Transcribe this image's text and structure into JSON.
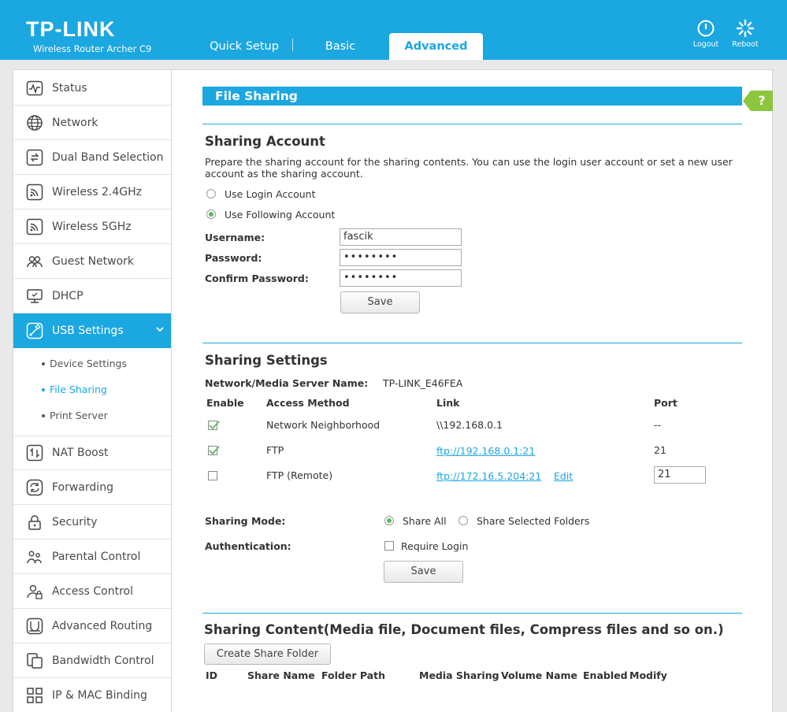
{
  "header": {
    "brand": "TP-LINK",
    "model": "Wireless Router Archer C9",
    "tabs": [
      {
        "label": "Quick Setup"
      },
      {
        "label": "Basic"
      },
      {
        "label": "Advanced"
      }
    ],
    "logout_label": "Logout",
    "reboot_label": "Reboot",
    "accent_color": "#1ba7e0"
  },
  "sidebar": {
    "items": [
      {
        "label": "Status",
        "icon": "status-icon"
      },
      {
        "label": "Network",
        "icon": "globe-icon"
      },
      {
        "label": "Dual Band Selection",
        "icon": "dual-band-icon"
      },
      {
        "label": "Wireless 2.4GHz",
        "icon": "wireless-icon"
      },
      {
        "label": "Wireless 5GHz",
        "icon": "wireless-icon"
      },
      {
        "label": "Guest Network",
        "icon": "guest-icon"
      },
      {
        "label": "DHCP",
        "icon": "monitor-icon"
      },
      {
        "label": "USB Settings",
        "icon": "usb-icon"
      },
      {
        "label": "NAT Boost",
        "icon": "nat-boost-icon"
      },
      {
        "label": "Forwarding",
        "icon": "forwarding-icon"
      },
      {
        "label": "Security",
        "icon": "lock-icon"
      },
      {
        "label": "Parental Control",
        "icon": "parental-icon"
      },
      {
        "label": "Access Control",
        "icon": "access-control-icon"
      },
      {
        "label": "Advanced Routing",
        "icon": "routing-icon"
      },
      {
        "label": "Bandwidth Control",
        "icon": "bandwidth-icon"
      },
      {
        "label": "IP & MAC Binding",
        "icon": "binding-icon"
      }
    ],
    "submenu": [
      {
        "label": "Device Settings"
      },
      {
        "label": "File Sharing"
      },
      {
        "label": "Print Server"
      }
    ]
  },
  "page": {
    "title": "File Sharing",
    "help": "?"
  },
  "sharing_account": {
    "title": "Sharing Account",
    "description": "Prepare the sharing account for the sharing contents. You can use the login user account or set a new user account as the sharing account.",
    "option_login": "Use Login Account",
    "option_following": "Use Following Account",
    "username_label": "Username:",
    "username_value": "fascik",
    "password_label": "Password:",
    "password_value": "••••••••",
    "confirm_label": "Confirm Password:",
    "confirm_value": "••••••••",
    "save_label": "Save"
  },
  "sharing_settings": {
    "title": "Sharing Settings",
    "server_name_label": "Network/Media Server Name:",
    "server_name_value": "TP-LINK_E46FEA",
    "columns": {
      "enable": "Enable",
      "method": "Access Method",
      "link": "Link",
      "port": "Port"
    },
    "rows": [
      {
        "method": "Network Neighborhood",
        "link": "\\\\192.168.0.1",
        "port": "--"
      },
      {
        "method": "FTP",
        "link": "ftp://192.168.0.1:21",
        "port": "21"
      },
      {
        "method": "FTP (Remote)",
        "link": "ftp://172.16.5.204:21",
        "edit": "Edit",
        "port": "21"
      }
    ],
    "mode_label": "Sharing Mode:",
    "mode_all": "Share All",
    "mode_selected": "Share Selected Folders",
    "auth_label": "Authentication:",
    "auth_option": "Require Login",
    "save_label": "Save"
  },
  "sharing_content": {
    "title": "Sharing Content(Media file, Document files, Compress files and so on.)",
    "create_label": "Create Share Folder",
    "columns": [
      "ID",
      "Share Name",
      "Folder Path",
      "Media Sharing",
      "Volume Name",
      "Enabled",
      "Modify"
    ]
  }
}
